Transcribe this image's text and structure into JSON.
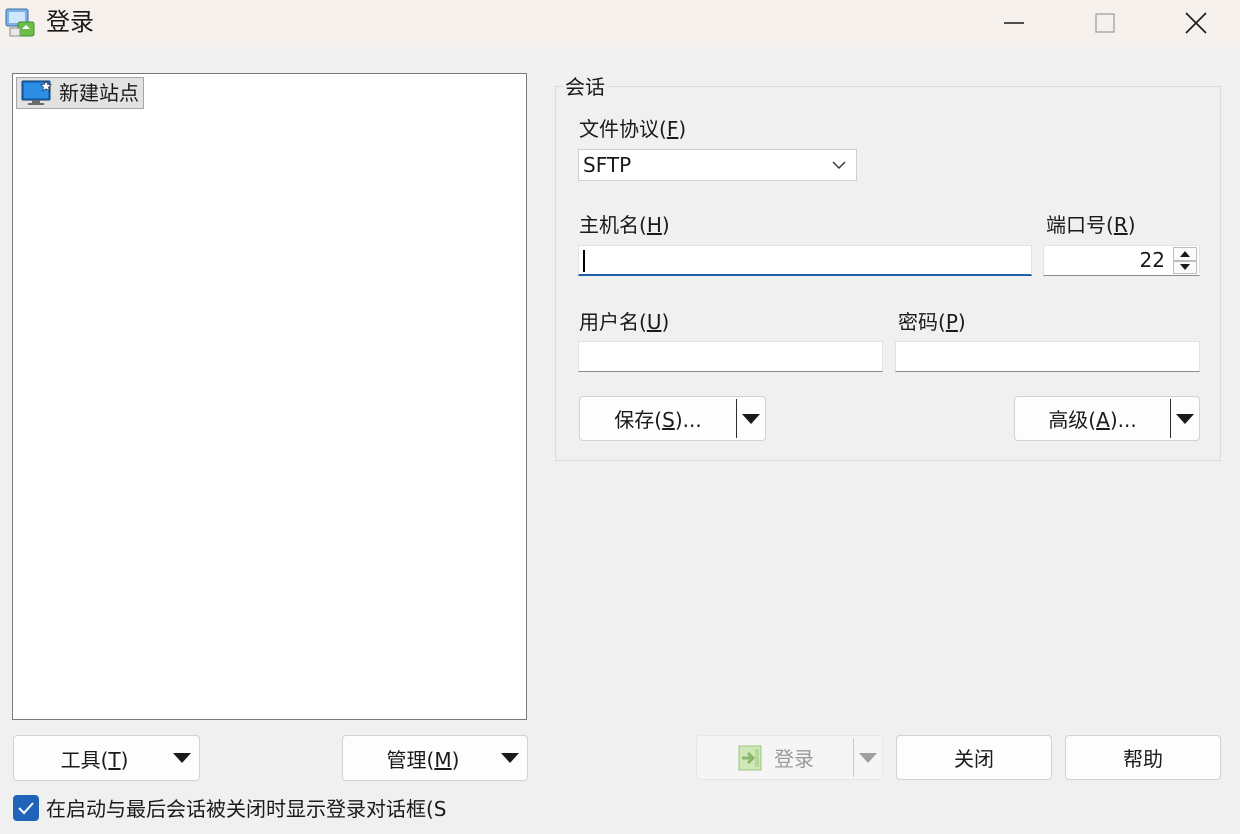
{
  "window": {
    "title": "登录",
    "icons": {
      "app": "winscp-login-icon",
      "minimize": "minimize-icon",
      "maximize": "maximize-icon",
      "close": "close-icon"
    }
  },
  "site_tree": {
    "items": [
      {
        "label": "新建站点",
        "icon": "new-site-monitor-icon"
      }
    ]
  },
  "session": {
    "group_title": "会话",
    "protocol": {
      "label": "文件协议(",
      "mnemonic": "F",
      "label_end": ")",
      "value": "SFTP"
    },
    "host": {
      "label": "主机名(",
      "mnemonic": "H",
      "label_end": ")",
      "value": ""
    },
    "port": {
      "label": "端口号(",
      "mnemonic": "R",
      "label_end": ")",
      "value": "22"
    },
    "username": {
      "label": "用户名(",
      "mnemonic": "U",
      "label_end": ")",
      "value": ""
    },
    "password": {
      "label": "密码(",
      "mnemonic": "P",
      "label_end": ")",
      "value": ""
    },
    "save_button": {
      "label": "保存(",
      "mnemonic": "S",
      "label_end": ")..."
    },
    "advanced_button": {
      "label": "高级(",
      "mnemonic": "A",
      "label_end": ")..."
    }
  },
  "footer": {
    "tools_button": {
      "label": "工具(",
      "mnemonic": "T",
      "label_end": ")"
    },
    "manage_button": {
      "label": "管理(",
      "mnemonic": "M",
      "label_end": ")"
    },
    "login_button": {
      "label": "登录",
      "enabled": false
    },
    "close_button": {
      "label": "关闭"
    },
    "help_button": {
      "label": "帮助"
    },
    "startup_checkbox": {
      "label": "在启动与最后会话被关闭时显示登录对话框(S",
      "checked": true
    }
  },
  "colors": {
    "accent": "#1f64b8",
    "title_bar": "#f7f1ee",
    "window_bg": "#f0f0f0"
  }
}
